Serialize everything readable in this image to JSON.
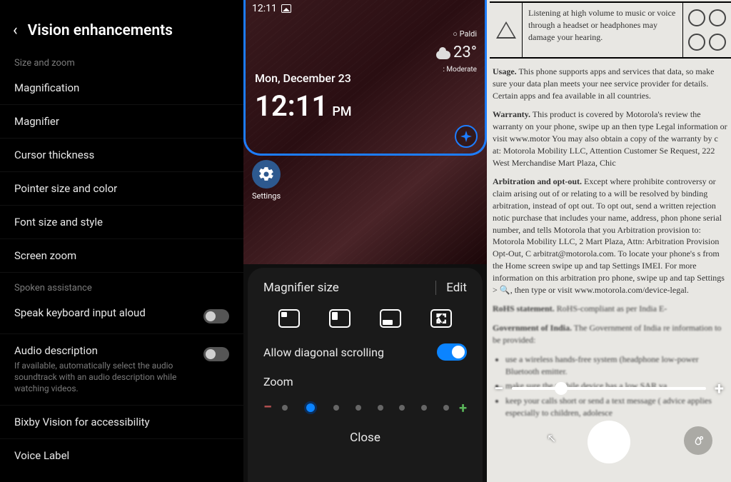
{
  "left": {
    "title": "Vision enhancements",
    "section1": "Size and zoom",
    "items1": [
      "Magnification",
      "Magnifier",
      "Cursor thickness",
      "Pointer size and color",
      "Font size and style",
      "Screen zoom"
    ],
    "section2": "Spoken assistance",
    "speak_keyboard": "Speak keyboard input aloud",
    "audio_desc_title": "Audio description",
    "audio_desc_sub": "If available, automatically select the audio soundtrack with an audio description while watching videos.",
    "bixby": "Bixby Vision for accessibility",
    "voice_label": "Voice Label"
  },
  "mid": {
    "status_time": "12:11",
    "weather_loc": "Paldi",
    "weather_temp": "23°",
    "weather_cond": "Moderate",
    "date": "Mon, December 23",
    "big_time": "12:11",
    "ampm": "PM",
    "app_settings": "Settings",
    "sheet_title": "Magnifier size",
    "sheet_edit": "Edit",
    "diag_scroll": "Allow diagonal scrolling",
    "zoom": "Zoom",
    "close": "Close"
  },
  "right": {
    "hdr_warning": "Listening at high volume to music or voice through a headset or headphones may damage your hearing.",
    "p_usage": "This phone supports apps and services that data, so make sure your data plan meets your nee service provider for details. Certain apps and fea available in all countries.",
    "p_warranty": "This product is covered by Motorola's review the warranty on your phone, swipe up an then type Legal information or visit www.motor You may also obtain a copy of the warranty by c at: Motorola Mobility LLC, Attention Customer Se Request, 222 West Merchandise Mart Plaza, Chic",
    "p_arbitration": "Except where prohibite controversy or claim arising out of or relating to a will be resolved by binding arbitration, instead of opt out. To opt out, send a written rejection notic purchase that includes your name, address, phon phone serial number, and tells Motorola that you Arbitration provision to: Motorola Mobility LLC, 2 Mart Plaza, Attn: Arbitration Provision Opt-Out, C arbitrat@motorola.com. To locate your phone's s from the Home screen swipe up and tap Settings IMEI. For more information on this arbitration pro phone, swipe up and tap Settings > 🔍, then type or visit www.motorola.com/device-legal.",
    "p_rohs": "RoHS-compliant as per India E-",
    "p_india": "The Government of India re information to be provided:",
    "li1": "use a wireless hands-free system (headphone low-power Bluetooth emitter.",
    "li2": "make sure the mobile device has a low SAR va",
    "li3": "keep your calls short or send a text message ( advice applies especially to children, adolesce"
  }
}
